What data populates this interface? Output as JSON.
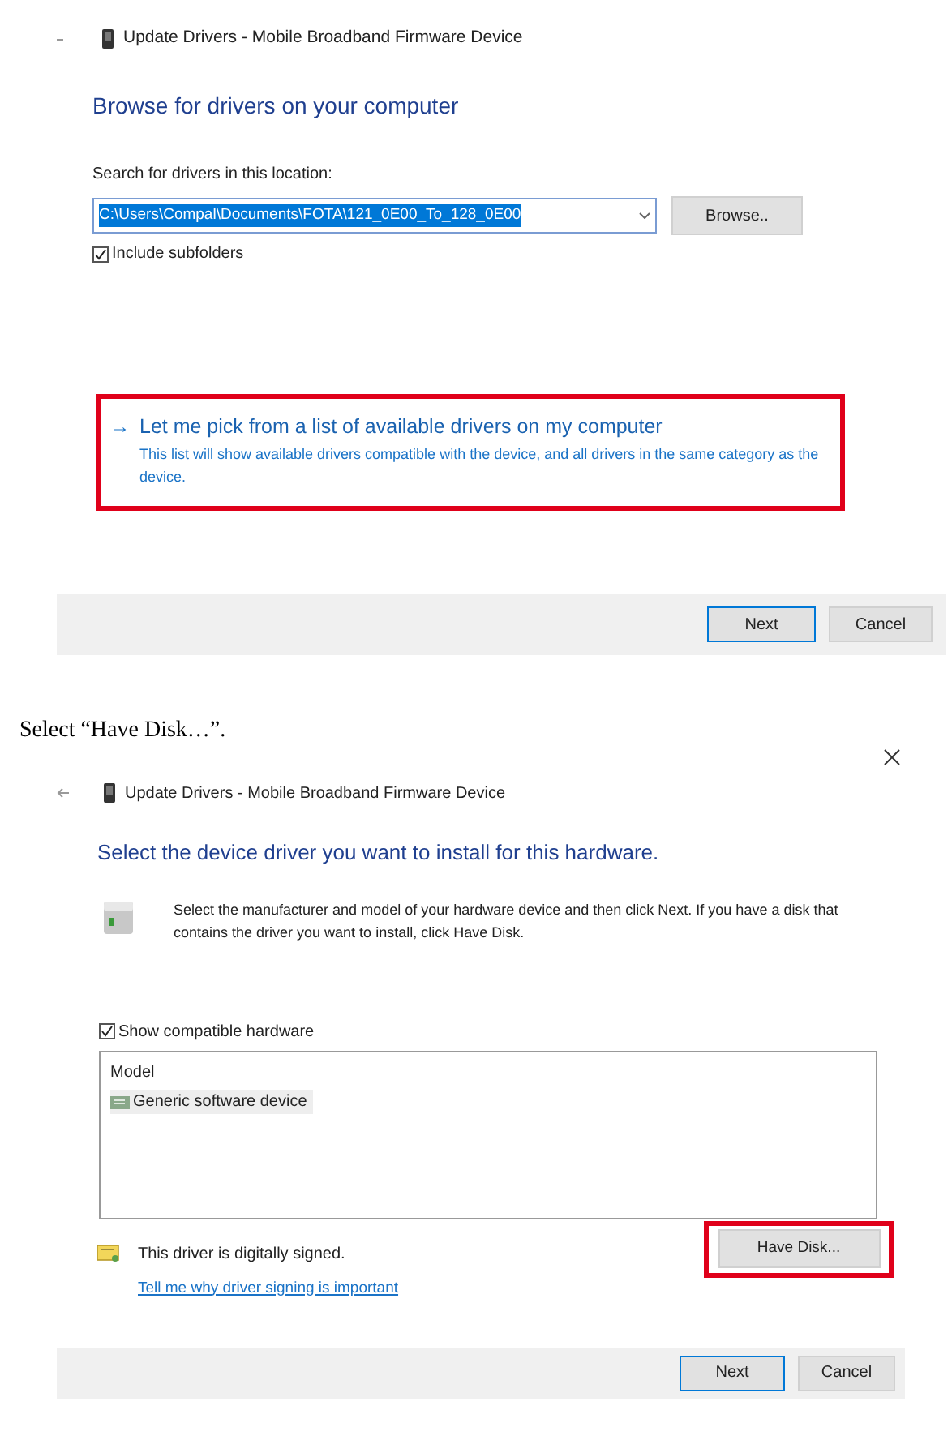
{
  "browse_dialog": {
    "title": "Update Drivers - Mobile Broadband Firmware Device",
    "heading": "Browse for drivers on your computer",
    "location_label": "Search for drivers in this location:",
    "path_value": "C:\\Users\\Compal\\Documents\\FOTA\\121_0E00_To_128_0E00",
    "browse_button": "Browse..",
    "include_subfolders": {
      "label": "Include subfolders",
      "checked": true
    },
    "pick_option": {
      "arrow": "→",
      "title": "Let me pick from a list of available drivers on my computer",
      "description": "This list will show available drivers compatible with the device, and all drivers in the same category as the device.",
      "highlighted": true
    },
    "buttons": [
      {
        "label": "Next",
        "selected": true
      },
      {
        "label": "Cancel",
        "selected": false
      }
    ]
  },
  "instruction": "Select “Have Disk…”.",
  "select_dialog": {
    "title": "Update Drivers - Mobile Broadband Firmware Device",
    "heading": "Select the device driver you want to install for this hardware.",
    "description": "Select the manufacturer and model of your hardware device and then click Next. If you have a disk that contains the driver you want to install, click Have Disk.",
    "show_compatible": {
      "label": "Show compatible hardware",
      "checked": true
    },
    "list_header": "Model",
    "models": [
      {
        "label": "Generic software device",
        "selected": true
      }
    ],
    "signed_text": "This driver is digitally signed.",
    "signing_link": "Tell me why driver signing is important",
    "have_disk": {
      "label": "Have Disk...",
      "highlighted": true
    },
    "buttons": [
      {
        "label": "Next",
        "selected": true
      },
      {
        "label": "Cancel",
        "selected": false
      }
    ]
  }
}
